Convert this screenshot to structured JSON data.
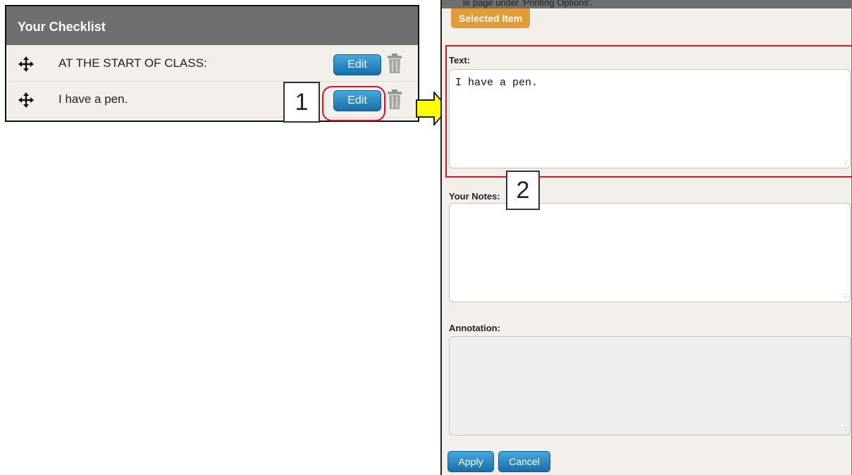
{
  "checklist": {
    "title": "Your Checklist",
    "items": [
      {
        "label": "AT THE START OF CLASS:",
        "edit_label": "Edit"
      },
      {
        "label": "I have a pen.",
        "edit_label": "Edit"
      }
    ]
  },
  "callouts": {
    "step1": "1",
    "step2": "2"
  },
  "panel": {
    "top_fragment": "le page under 'Printing Options'.",
    "tab_label": "Selected Item",
    "text_label": "Text:",
    "text_value": "I have a pen.",
    "notes_label": "Your Notes:",
    "notes_value": "",
    "annotation_label": "Annotation:",
    "apply_label": "Apply",
    "cancel_label": "Cancel"
  },
  "colors": {
    "header_gray": "#6f6f6f",
    "panel_bg": "#f3efea",
    "button_blue": "#1a6fa9",
    "tab_orange": "#e39b36",
    "highlight_red": "#e0102a",
    "arrow_yellow": "#ffff00"
  }
}
